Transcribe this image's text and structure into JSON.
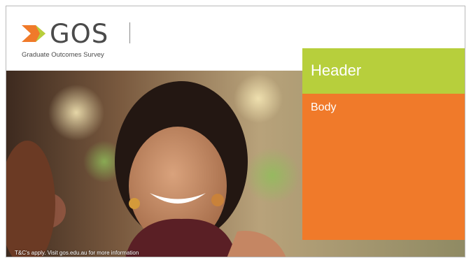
{
  "logo": {
    "wordmark": "GOS",
    "tagline": "Graduate Outcomes Survey",
    "mark_icon": "chevron-arrow-logo-icon",
    "colors": {
      "arrow_orange": "#f07a2a",
      "arrow_green": "#b7cf3c",
      "text": "#4a4a4a"
    }
  },
  "panel": {
    "header": "Header",
    "body": "Body",
    "header_color": "#b7cf3c",
    "body_color": "#f07a2a"
  },
  "hero": {
    "image": "smiling-woman-photo"
  },
  "footer": {
    "note": "T&C's apply. Visit gos.edu.au for more information"
  }
}
